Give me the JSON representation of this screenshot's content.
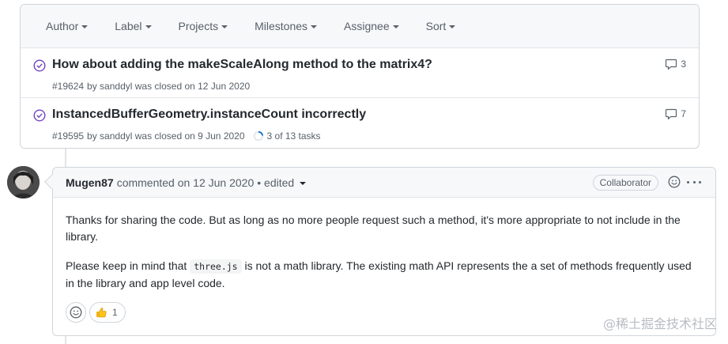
{
  "filters": [
    "Author",
    "Label",
    "Projects",
    "Milestones",
    "Assignee",
    "Sort"
  ],
  "issues": [
    {
      "title": "How about adding the makeScaleAlong method to the matrix4?",
      "number": "#19624",
      "meta": "by sanddyl was closed on 12 Jun 2020",
      "comments": "3",
      "tasks": ""
    },
    {
      "title": "InstancedBufferGeometry.instanceCount incorrectly",
      "number": "#19595",
      "meta": "by sanddyl was closed on 9 Jun 2020",
      "comments": "7",
      "tasks": "3 of 13 tasks",
      "tasks_progress": 0.23
    }
  ],
  "comment": {
    "author": "Mugen87",
    "action": "commented on 12 Jun 2020",
    "edited": "• edited",
    "badge": "Collaborator",
    "para1": "Thanks for sharing the code. But as long as no more people request such a method, it's more appropriate to not include in the library.",
    "para2_before": "Please keep in mind that",
    "code": "three.js",
    "para2_after": "is not a math library. The existing math API represents the a set of methods frequently used in the library and app level code.",
    "reaction_count": "1"
  },
  "watermark": "@稀土掘金技术社区",
  "colors": {
    "closed_purple": "#6f42c1",
    "border": "#d1d5da",
    "muted": "#586069"
  },
  "icons": {
    "closed": "issue-closed-icon",
    "comment": "comment-icon",
    "smiley": "smiley-icon",
    "thumbsup": "thumbsup-icon"
  }
}
